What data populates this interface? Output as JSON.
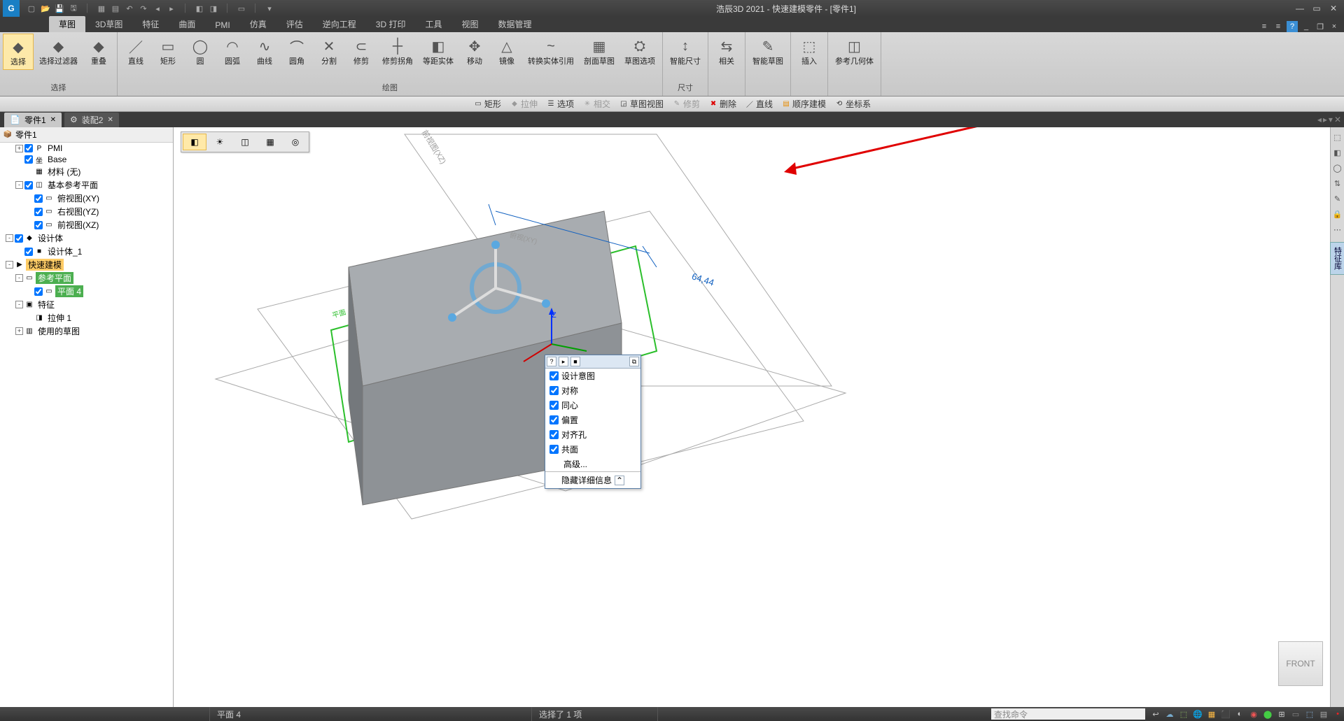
{
  "app": {
    "title": "浩辰3D 2021 - 快速建模零件 - [零件1]"
  },
  "qat_icons": [
    "new",
    "open",
    "save",
    "saveall",
    "|",
    "tbl",
    "grid",
    "undo",
    "redo",
    "prev",
    "next",
    "|",
    "obj1",
    "obj2",
    "|",
    "cursor",
    "|",
    "more"
  ],
  "ribbon_tabs": [
    "草图",
    "3D草图",
    "特征",
    "曲面",
    "PMI",
    "仿真",
    "评估",
    "逆向工程",
    "3D 打印",
    "工具",
    "视图",
    "数据管理"
  ],
  "ribbon_active": 0,
  "ribbon": {
    "groups": [
      {
        "label": "选择",
        "buttons": [
          {
            "txt": "选择",
            "sel": true
          },
          {
            "txt": "选择过滤器"
          },
          {
            "txt": "重叠"
          }
        ]
      },
      {
        "label": "绘图",
        "buttons": [
          {
            "txt": "直线",
            "ic": "／"
          },
          {
            "txt": "矩形",
            "ic": "▭"
          },
          {
            "txt": "圆",
            "ic": "◯"
          },
          {
            "txt": "圆弧",
            "ic": "◠"
          },
          {
            "txt": "曲线",
            "ic": "∿"
          },
          {
            "txt": "圆角",
            "ic": "⌒"
          },
          {
            "txt": "分割",
            "ic": "✕"
          },
          {
            "txt": "修剪",
            "ic": "⊂"
          },
          {
            "txt": "修剪拐角",
            "ic": "┼"
          },
          {
            "txt": "等距实体",
            "ic": "◧"
          },
          {
            "txt": "移动",
            "ic": "✥"
          },
          {
            "txt": "镜像",
            "ic": "△"
          },
          {
            "txt": "转换实体引用",
            "ic": "~"
          },
          {
            "txt": "剖面草图",
            "ic": "▦"
          },
          {
            "txt": "草图选项",
            "ic": "⛭"
          }
        ]
      },
      {
        "label": "尺寸",
        "buttons": [
          {
            "txt": "智能尺寸",
            "ic": "↕"
          }
        ]
      },
      {
        "label": "",
        "buttons": [
          {
            "txt": "相关",
            "ic": "⇆"
          }
        ]
      },
      {
        "label": "",
        "buttons": [
          {
            "txt": "智能草图",
            "ic": "✎"
          }
        ]
      },
      {
        "label": "",
        "buttons": [
          {
            "txt": "插入",
            "ic": "⬚"
          }
        ]
      },
      {
        "label": "",
        "buttons": [
          {
            "txt": "参考几何体",
            "ic": "◫"
          }
        ]
      }
    ]
  },
  "context_bar": [
    {
      "t": "矩形",
      "ic": "▭"
    },
    {
      "t": "拉伸",
      "ic": "◆",
      "dis": true
    },
    {
      "t": "选项",
      "ic": "☰"
    },
    {
      "t": "相交",
      "ic": "✳",
      "dis": true
    },
    {
      "t": "草图视图",
      "ic": "◲"
    },
    {
      "t": "修剪",
      "ic": "✎",
      "dis": true
    },
    {
      "t": "删除",
      "ic": "✖",
      "red": true
    },
    {
      "t": "直线",
      "ic": "／"
    },
    {
      "t": "顺序建模",
      "ic": "▤",
      "orange": true
    },
    {
      "t": "坐标系",
      "ic": "⟲"
    }
  ],
  "doc_tabs": [
    {
      "t": "零件1",
      "active": true
    },
    {
      "t": "装配2"
    }
  ],
  "tree": {
    "root": "零件1",
    "items": [
      {
        "ind": 1,
        "exp": "+",
        "cb": true,
        "txt": "PMI",
        "ic": "P"
      },
      {
        "ind": 1,
        "exp": "",
        "cb": true,
        "txt": "Base",
        "ic": "坐"
      },
      {
        "ind": 2,
        "exp": "",
        "cb": false,
        "txt": "材料 (无)",
        "ic": "▦"
      },
      {
        "ind": 1,
        "exp": "-",
        "cb": true,
        "txt": "基本参考平面",
        "ic": "◫"
      },
      {
        "ind": 2,
        "exp": "",
        "cb": true,
        "txt": "俯视图(XY)",
        "ic": "▭"
      },
      {
        "ind": 2,
        "exp": "",
        "cb": true,
        "txt": "右视图(YZ)",
        "ic": "▭"
      },
      {
        "ind": 2,
        "exp": "",
        "cb": true,
        "txt": "前视图(XZ)",
        "ic": "▭"
      },
      {
        "ind": 0,
        "exp": "-",
        "cb": true,
        "txt": "设计体",
        "ic": "◆"
      },
      {
        "ind": 1,
        "exp": "",
        "cb": true,
        "txt": "设计体_1",
        "ic": "■"
      },
      {
        "ind": 0,
        "exp": "-",
        "cb": false,
        "txt": "快速建模",
        "ic": "▶",
        "cls": "sel-orange"
      },
      {
        "ind": 1,
        "exp": "-",
        "cb": false,
        "txt": "参考平面",
        "ic": "▭",
        "cls": "sel-green"
      },
      {
        "ind": 2,
        "exp": "",
        "cb": true,
        "txt": "平面 4",
        "ic": "▭",
        "cls": "sel-green"
      },
      {
        "ind": 1,
        "exp": "-",
        "cb": false,
        "txt": "特征",
        "ic": "▣"
      },
      {
        "ind": 2,
        "exp": "",
        "cb": false,
        "txt": "拉伸 1",
        "ic": "◨"
      },
      {
        "ind": 1,
        "exp": "+",
        "cb": false,
        "txt": "使用的草图",
        "ic": "▥"
      }
    ]
  },
  "viewport": {
    "dim": "64,44",
    "plane_front": "前视图(XZ)",
    "plane_top": "俯视(XY)",
    "axis_z": "Z",
    "axis_plane": "平面"
  },
  "popup": {
    "head_icons": [
      "?",
      "▸",
      "■"
    ],
    "pin": "⧉",
    "rows": [
      {
        "t": "设计意图",
        "cb": true
      },
      {
        "t": "对称",
        "cb": true
      },
      {
        "t": "同心",
        "cb": true
      },
      {
        "t": "偏置",
        "cb": true
      },
      {
        "t": "对齐孔",
        "cb": true
      },
      {
        "t": "共面",
        "cb": true
      },
      {
        "t": "高级...",
        "cb": false,
        "nocheck": true
      }
    ],
    "foot": "隐藏详细信息",
    "foot_ic": "⌃"
  },
  "right_rail": [
    "⬚",
    "◧",
    "◯",
    "⇅",
    "✎",
    "🔒",
    "⋯"
  ],
  "right_vtab": "特征库",
  "status": {
    "left": "",
    "plane": "平面 4",
    "sel": "选择了 1 项",
    "cmd_placeholder": "查找命令",
    "icons": [
      "↩",
      "☁",
      "⬚",
      "🌐",
      "▦",
      "⬛",
      "◐",
      "◉",
      "⬤",
      "⊞",
      "▭",
      "⬚",
      "▤",
      "•"
    ]
  },
  "viewcube": "FRONT"
}
